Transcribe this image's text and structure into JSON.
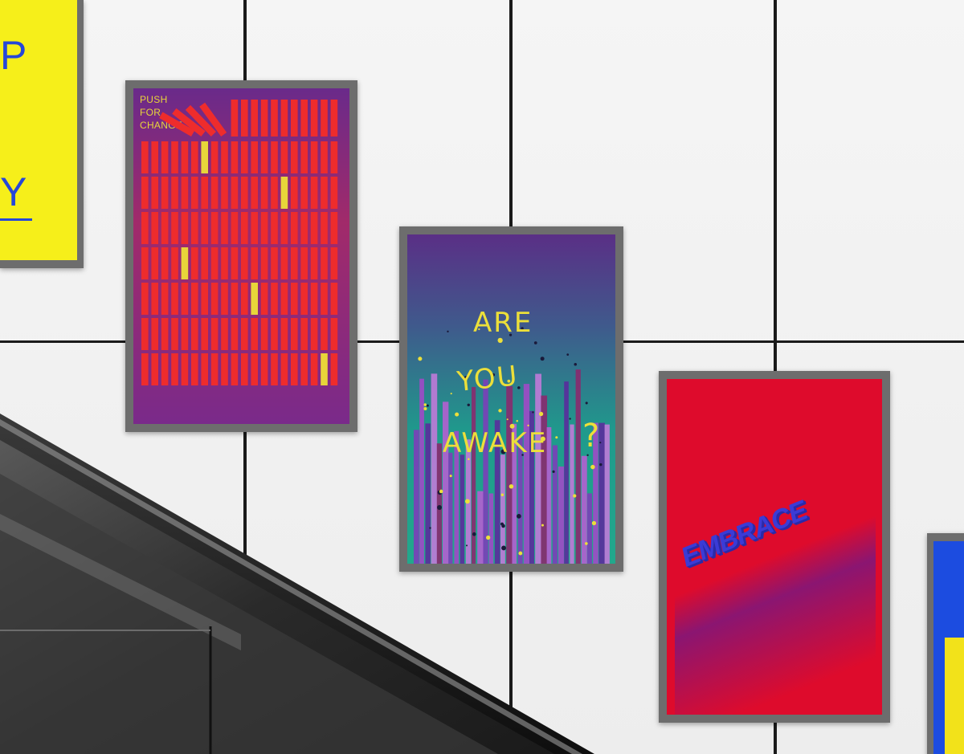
{
  "scene": {
    "description": "Subway-style white tiled wall with posters above an escalator"
  },
  "posters": {
    "push_for_change": {
      "lines": [
        "PUSH",
        "FOR",
        "CHANGE"
      ],
      "background_top": "#6a2a8a",
      "block_color": "#ee2c2c",
      "highlight_color": "#e8d53a"
    },
    "are_you_awake": {
      "words": [
        "ARE",
        "YOU",
        "AWAKE",
        "?"
      ],
      "text_color": "#ecdf3a",
      "gradient": [
        "#5a2f86",
        "#1f9a8c"
      ]
    },
    "embrace": {
      "word": "EMBRACE",
      "background": "#de0b2c",
      "text_color": "#3b3bd6"
    },
    "left_partial": {
      "background": "#f6ef1a",
      "glyph_color": "#2647d8"
    },
    "right_partial": {
      "background": "#1c4ce0"
    }
  }
}
